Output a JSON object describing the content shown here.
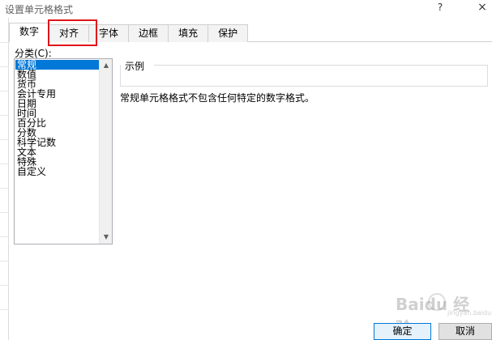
{
  "window": {
    "title": "设置单元格格式",
    "help_glyph": "?",
    "close_glyph": "×"
  },
  "tabs": [
    {
      "label": "数字",
      "active": true
    },
    {
      "label": "对齐",
      "active": false
    },
    {
      "label": "字体",
      "active": false
    },
    {
      "label": "边框",
      "active": false
    },
    {
      "label": "填充",
      "active": false
    },
    {
      "label": "保护",
      "active": false
    }
  ],
  "category": {
    "label": "分类(C):",
    "items": [
      "常规",
      "数值",
      "货币",
      "会计专用",
      "日期",
      "时间",
      "百分比",
      "分数",
      "科学记数",
      "文本",
      "特殊",
      "自定义"
    ],
    "selected_index": 0
  },
  "sample": {
    "label": "示例",
    "value": ""
  },
  "description": "常规单元格格式不包含任何特定的数字格式。",
  "buttons": {
    "ok": "确定",
    "cancel": "取消"
  },
  "watermark": {
    "text": "Baidu 经验",
    "sub": "jingyan.baidu.com"
  },
  "colors": {
    "highlight_border": "#e0151b",
    "selection": "#0078d7"
  }
}
